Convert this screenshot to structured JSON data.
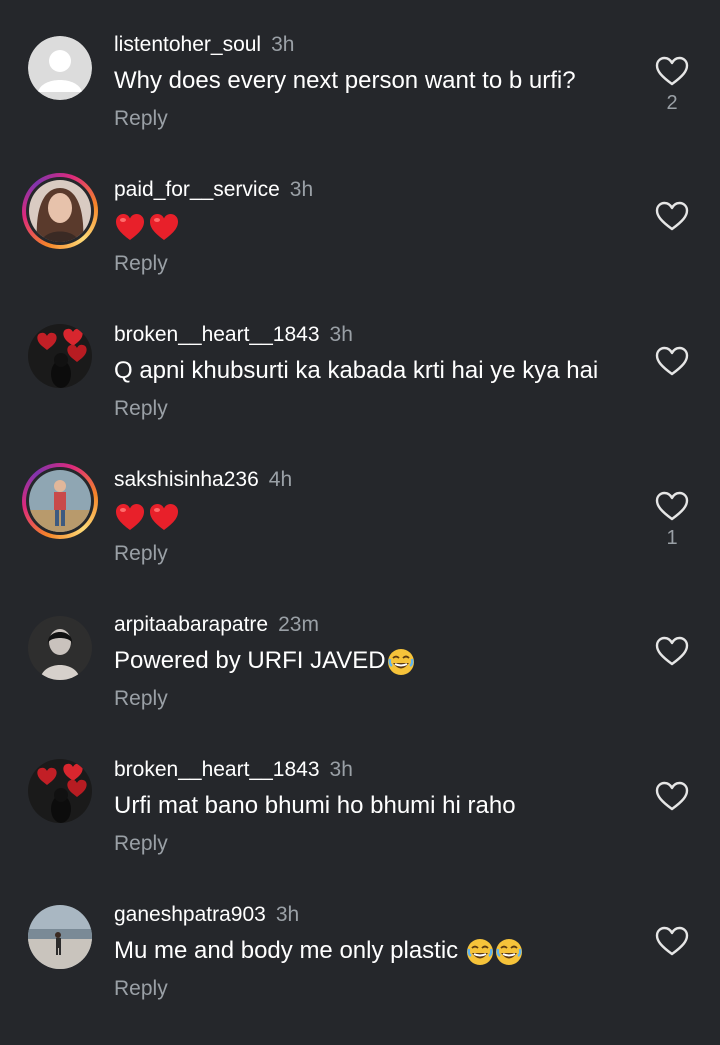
{
  "comments": [
    {
      "username": "listentoher_soul",
      "time": "3h",
      "text": "Why does every next person want to b urfi?",
      "reply_label": "Reply",
      "like_count": "2",
      "avatar": "default-avatar"
    },
    {
      "username": "paid_for__service",
      "time": "3h",
      "text": "",
      "emojis": [
        "red-heart",
        "red-heart"
      ],
      "reply_label": "Reply",
      "like_count": "",
      "avatar": "story-ring-avatar"
    },
    {
      "username": "broken__heart__1843",
      "time": "3h",
      "text": "Q apni khubsurti ka kabada krti hai ye kya hai",
      "reply_label": "Reply",
      "like_count": "",
      "avatar": "hearts-avatar"
    },
    {
      "username": "sakshisinha236",
      "time": "4h",
      "text": "",
      "emojis": [
        "red-heart",
        "red-heart"
      ],
      "reply_label": "Reply",
      "like_count": "1",
      "avatar": "story-ring-avatar"
    },
    {
      "username": "arpitaabarapatre",
      "time": "23m",
      "text": "Powered by URFI JAVED",
      "emojis": [
        "laughing-face"
      ],
      "reply_label": "Reply",
      "like_count": "",
      "avatar": "photo-avatar"
    },
    {
      "username": "broken__heart__1843",
      "time": "3h",
      "text": "Urfi mat bano bhumi ho bhumi hi raho",
      "reply_label": "Reply",
      "like_count": "",
      "avatar": "hearts-avatar"
    },
    {
      "username": "ganeshpatra903",
      "time": "3h",
      "text": "Mu me and body me only plastic ",
      "emojis": [
        "laughing-face",
        "laughing-face"
      ],
      "reply_label": "Reply",
      "like_count": "",
      "avatar": "beach-avatar"
    }
  ],
  "colors": {
    "background": "#25272b",
    "text_primary": "#ffffff",
    "text_secondary": "#9aa0a6",
    "heart_emoji": "#e8202a",
    "story_ring": "#dd2a7b"
  }
}
